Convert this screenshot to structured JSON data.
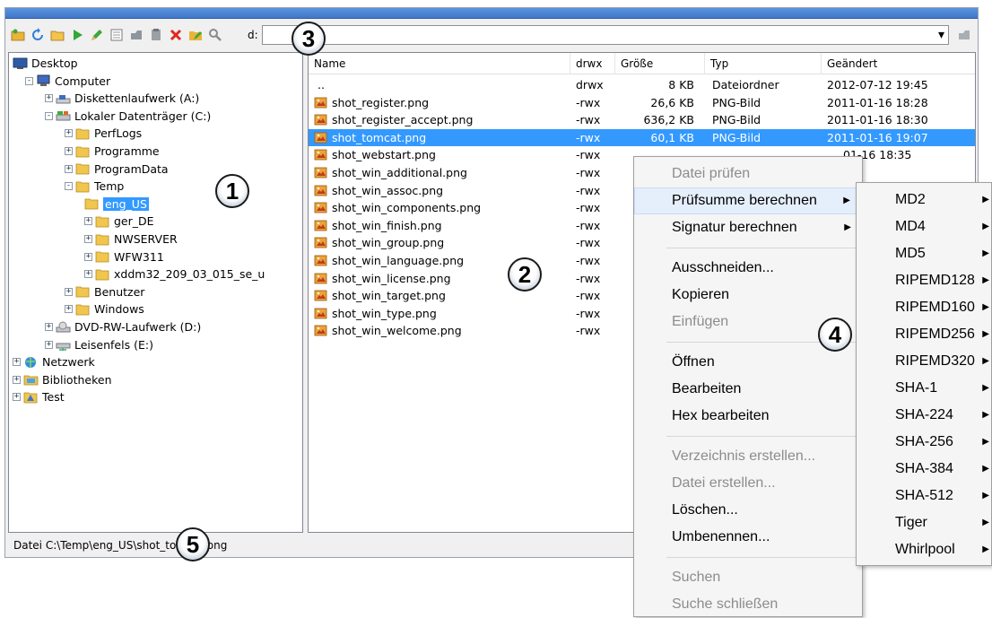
{
  "toolbar": {
    "path_label": "d:",
    "path_value": "",
    "dropdown_glyph": "▾",
    "icons": [
      "open-folder-icon",
      "refresh-icon",
      "new-folder-icon",
      "play-icon",
      "edit-pencil-icon",
      "hex-icon",
      "copy-icon",
      "paste-icon",
      "delete-icon",
      "rename-icon",
      "search-icon"
    ]
  },
  "tree": {
    "nodes": [
      {
        "label": "Desktop",
        "icon": "desktop-icon"
      },
      {
        "label": "Computer",
        "icon": "computer-icon"
      },
      {
        "label": "Diskettenlaufwerk (A:)",
        "icon": "floppy-drive-icon"
      },
      {
        "label": "Lokaler Datenträger (C:)",
        "icon": "hard-drive-icon"
      },
      {
        "label": "PerfLogs",
        "icon": "folder-icon"
      },
      {
        "label": "Programme",
        "icon": "folder-icon"
      },
      {
        "label": "ProgramData",
        "icon": "folder-icon"
      },
      {
        "label": "Temp",
        "icon": "folder-icon"
      },
      {
        "label": "eng_US",
        "icon": "folder-icon"
      },
      {
        "label": "ger_DE",
        "icon": "folder-icon"
      },
      {
        "label": "NWSERVER",
        "icon": "folder-icon"
      },
      {
        "label": "WFW311",
        "icon": "folder-icon"
      },
      {
        "label": "xddm32_209_03_015_se_u",
        "icon": "folder-icon"
      },
      {
        "label": "Benutzer",
        "icon": "folder-icon"
      },
      {
        "label": "Windows",
        "icon": "folder-icon"
      },
      {
        "label": "DVD-RW-Laufwerk (D:)",
        "icon": "dvd-drive-icon"
      },
      {
        "label": "Leisenfels (E:)",
        "icon": "network-drive-icon"
      },
      {
        "label": "Netzwerk",
        "icon": "network-icon"
      },
      {
        "label": "Bibliotheken",
        "icon": "library-icon"
      },
      {
        "label": "Test",
        "icon": "test-folder-icon"
      }
    ],
    "selected": "eng_US"
  },
  "filelist": {
    "columns": [
      "Name",
      "drwx",
      "Größe",
      "Typ",
      "Geändert"
    ],
    "rows": [
      {
        "name": "..",
        "perm": "drwx",
        "size": "8 KB",
        "type": "Dateiordner",
        "date": "2012-07-12  19:45"
      },
      {
        "name": "shot_register.png",
        "perm": "-rwx",
        "size": "26,6 KB",
        "type": "PNG-Bild",
        "date": "2011-01-16  18:28"
      },
      {
        "name": "shot_register_accept.png",
        "perm": "-rwx",
        "size": "636,2 KB",
        "type": "PNG-Bild",
        "date": "2011-01-16  18:30"
      },
      {
        "name": "shot_tomcat.png",
        "perm": "-rwx",
        "size": "60,1 KB",
        "type": "PNG-Bild",
        "date": "2011-01-16  19:07"
      },
      {
        "name": "shot_webstart.png",
        "perm": "-rwx",
        "size": "",
        "type": "",
        "date": "01-16  18:35"
      },
      {
        "name": "shot_win_additional.png",
        "perm": "-rwx",
        "size": "",
        "type": "",
        "date": ""
      },
      {
        "name": "shot_win_assoc.png",
        "perm": "-rwx",
        "size": "",
        "type": "",
        "date": ""
      },
      {
        "name": "shot_win_components.png",
        "perm": "-rwx",
        "size": "",
        "type": "",
        "date": ""
      },
      {
        "name": "shot_win_finish.png",
        "perm": "-rwx",
        "size": "",
        "type": "",
        "date": ""
      },
      {
        "name": "shot_win_group.png",
        "perm": "-rwx",
        "size": "",
        "type": "",
        "date": ""
      },
      {
        "name": "shot_win_language.png",
        "perm": "-rwx",
        "size": "",
        "type": "",
        "date": ""
      },
      {
        "name": "shot_win_license.png",
        "perm": "-rwx",
        "size": "",
        "type": "",
        "date": ""
      },
      {
        "name": "shot_win_target.png",
        "perm": "-rwx",
        "size": "",
        "type": "",
        "date": ""
      },
      {
        "name": "shot_win_type.png",
        "perm": "-rwx",
        "size": "",
        "type": "",
        "date": ""
      },
      {
        "name": "shot_win_welcome.png",
        "perm": "-rwx",
        "size": "",
        "type": "",
        "date": ""
      }
    ],
    "selected_index": 3
  },
  "context_menu": {
    "items": [
      {
        "label": "Datei prüfen",
        "disabled": true
      },
      {
        "label": "Prüfsumme berechnen",
        "submenu": true,
        "highlighted": true
      },
      {
        "label": "Signatur berechnen",
        "submenu": true
      },
      {
        "label": "Ausschneiden...",
        "sep_before": true
      },
      {
        "label": "Kopieren"
      },
      {
        "label": "Einfügen",
        "disabled": true
      },
      {
        "label": "Öffnen",
        "sep_before": true
      },
      {
        "label": "Bearbeiten"
      },
      {
        "label": "Hex bearbeiten"
      },
      {
        "label": "Verzeichnis erstellen...",
        "disabled": true,
        "sep_before": true
      },
      {
        "label": "Datei erstellen...",
        "disabled": true
      },
      {
        "label": "Löschen..."
      },
      {
        "label": "Umbenennen..."
      },
      {
        "label": "Suchen",
        "disabled": true,
        "sep_before": true
      },
      {
        "label": "Suche schließen",
        "disabled": true
      }
    ]
  },
  "checksum_submenu": {
    "items": [
      "MD2",
      "MD4",
      "MD5",
      "RIPEMD128",
      "RIPEMD160",
      "RIPEMD256",
      "RIPEMD320",
      "SHA-1",
      "SHA-224",
      "SHA-256",
      "SHA-384",
      "SHA-512",
      "Tiger",
      "Whirlpool"
    ]
  },
  "status": {
    "text": "Datei C:\\Temp\\eng_US\\shot_tomcat.png"
  },
  "callouts": [
    "1",
    "2",
    "3",
    "4",
    "5"
  ],
  "colors": {
    "selection": "#3399ff",
    "menu_bg": "#f5f5f5",
    "disabled_text": "#8c8c8c",
    "title_bar": "#4a84d8"
  }
}
